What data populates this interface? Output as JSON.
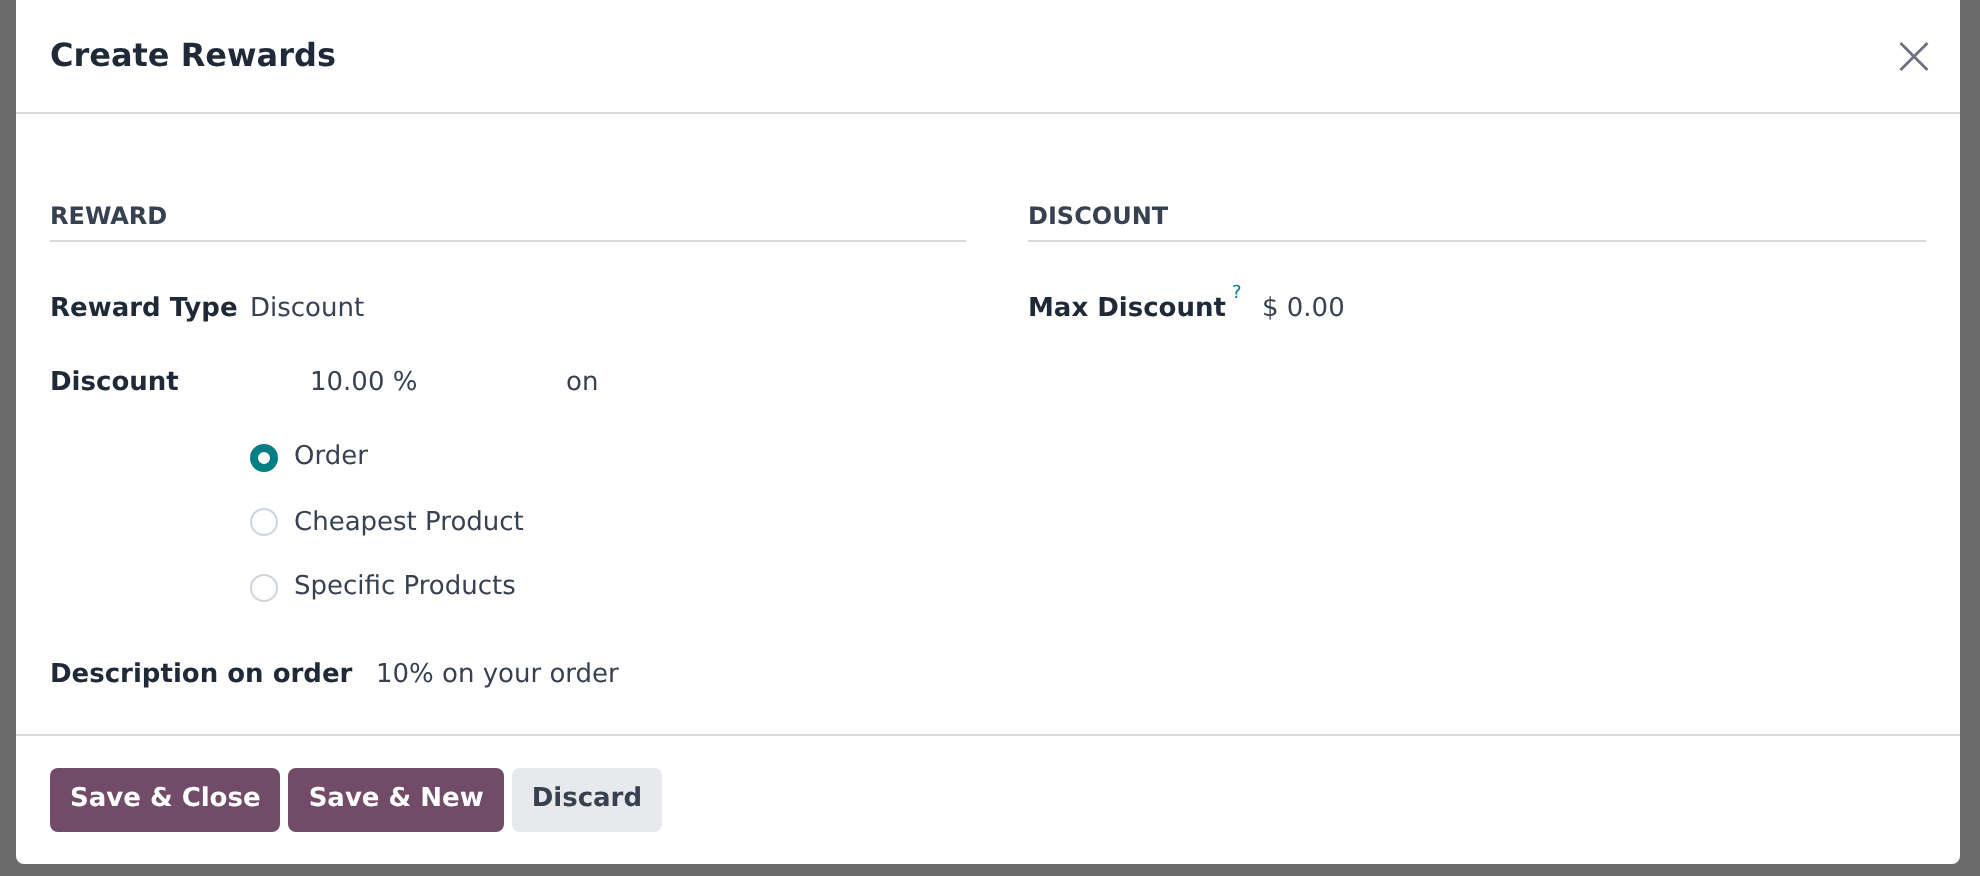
{
  "dialog": {
    "title": "Create Rewards",
    "close": "×"
  },
  "reward": {
    "heading": "REWARD",
    "reward_type": {
      "label": "Reward Type",
      "value": "Discount"
    },
    "discount": {
      "label": "Discount",
      "value": "10.00 %",
      "suffix": "on"
    },
    "apply_on": [
      {
        "label": "Order",
        "selected": true
      },
      {
        "label": "Cheapest Product",
        "selected": false
      },
      {
        "label": "Specific Products",
        "selected": false
      }
    ],
    "description": {
      "label": "Description on order",
      "value": "10% on your order"
    }
  },
  "discount": {
    "heading": "DISCOUNT",
    "max_discount": {
      "label": "Max Discount",
      "help": "?",
      "value": "$ 0.00"
    }
  },
  "buttons": [
    {
      "label": "Save & Close",
      "kind": "primary"
    },
    {
      "label": "Save & New",
      "kind": "primary"
    },
    {
      "label": "Discard",
      "kind": "secondary"
    }
  ]
}
